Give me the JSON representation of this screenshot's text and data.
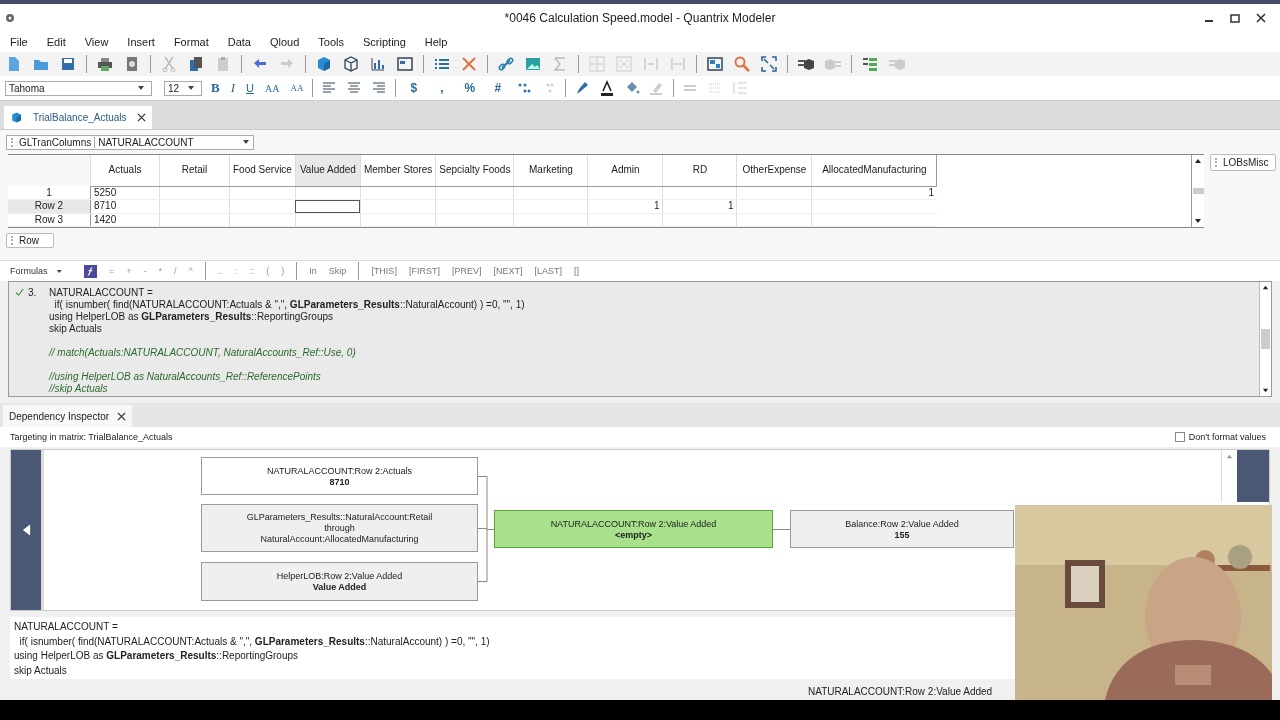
{
  "window": {
    "title": "*0046 Calculation Speed.model - Quantrix Modeler"
  },
  "menu": [
    "File",
    "Edit",
    "View",
    "Insert",
    "Format",
    "Data",
    "Qloud",
    "Tools",
    "Scripting",
    "Help"
  ],
  "format_toolbar": {
    "font": "Tahoma",
    "size": "12",
    "style_buttons": [
      {
        "label": "B",
        "kind": "bold"
      },
      {
        "label": "I",
        "kind": "italic"
      },
      {
        "label": "U",
        "kind": "underline"
      },
      {
        "label": "AA",
        "kind": "grow"
      },
      {
        "label": "AA",
        "kind": "shrink"
      }
    ],
    "number_buttons": [
      "$",
      ",",
      "%",
      "#"
    ]
  },
  "doc_tabs": [
    {
      "label": "TrialBalance_Actuals",
      "selected": true
    }
  ],
  "matrix": {
    "category": "GLTranColumns",
    "item": "NATURALACCOUNT",
    "columns": [
      {
        "label": "Actuals",
        "selected": false
      },
      {
        "label": "Retail",
        "selected": false
      },
      {
        "label": "Food Service",
        "selected": false
      },
      {
        "label": "Value Added",
        "selected": true
      },
      {
        "label": "Member Stores",
        "selected": false
      },
      {
        "label": "Sepcialty Foods",
        "selected": false
      },
      {
        "label": "Marketing",
        "selected": false
      },
      {
        "label": "Admin",
        "selected": false
      },
      {
        "label": "RD",
        "selected": false
      },
      {
        "label": "OtherExpense",
        "selected": false
      },
      {
        "label": "AllocatedManufacturing",
        "selected": false
      }
    ],
    "rows": [
      {
        "header": "1",
        "selected": false,
        "cells": [
          "5250",
          null,
          null,
          null,
          null,
          null,
          null,
          null,
          null,
          null,
          "1"
        ]
      },
      {
        "header": "Row 2",
        "selected": true,
        "cells": [
          "8710",
          null,
          null,
          null,
          null,
          null,
          null,
          "1",
          "1",
          null,
          null
        ]
      },
      {
        "header": "Row 3",
        "selected": false,
        "cells": [
          "1420",
          null,
          null,
          null,
          null,
          null,
          null,
          null,
          null,
          null,
          null
        ]
      }
    ],
    "row_category": "Row",
    "side_category": "LOBsMisc"
  },
  "formula_toolbar": {
    "mode": "Formulas",
    "operators": [
      "=",
      "+",
      "-",
      "*",
      "/",
      "^"
    ],
    "ranges": [
      "..",
      ":",
      "::",
      "(",
      ")"
    ],
    "keywords": [
      "In",
      "Skip"
    ],
    "references": [
      "[THIS]",
      "[FIRST]",
      "[PREV]",
      "[NEXT]",
      "[LAST]",
      "[]"
    ]
  },
  "formula_editor": {
    "number": "3.",
    "valid": true,
    "lines": [
      {
        "kind": "code",
        "text": "NATURALACCOUNT ="
      },
      {
        "kind": "code",
        "text": "  if( isnumber( find(NATURALACCOUNT:Actuals & \",\", **GLParameters_Results**::NaturalAccount) ) =0, \"\", 1)"
      },
      {
        "kind": "code",
        "text": "using HelperLOB as **GLParameters_Results**::ReportingGroups"
      },
      {
        "kind": "code",
        "text": "skip Actuals"
      },
      {
        "kind": "blank"
      },
      {
        "kind": "comment",
        "text": "// match(Actuals:NATURALACCOUNT, NaturalAccounts_Ref::Use, 0)"
      },
      {
        "kind": "blank"
      },
      {
        "kind": "comment",
        "text": "//using HelperLOB as NaturalAccounts_Ref::ReferencePoints"
      },
      {
        "kind": "comment",
        "text": "//skip Actuals"
      }
    ]
  },
  "inspector": {
    "tab": "Dependency Inspector",
    "target": "Targeting in matrix: TrialBalance_Actuals",
    "dont_format": {
      "label": "Don't format values",
      "checked": false
    },
    "nodes": [
      {
        "kind": "precedent",
        "shaded": false,
        "lines": [
          "NATURALACCOUNT:Row 2:Actuals"
        ],
        "value": "8710"
      },
      {
        "kind": "precedent",
        "shaded": true,
        "lines": [
          "GLParameters_Results::NaturalAccount:Retail",
          "through",
          "NaturalAccount:AllocatedManufacturing"
        ]
      },
      {
        "kind": "precedent",
        "shaded": true,
        "lines": [
          "HelperLOB:Row 2:Value Added"
        ],
        "value": "Value Added"
      },
      {
        "kind": "target",
        "shaded": false,
        "lines": [
          "NATURALACCOUNT:Row 2:Value Added"
        ],
        "value": "<empty>"
      },
      {
        "kind": "dependent",
        "shaded": true,
        "lines": [
          "Balance:Row 2:Value Added"
        ],
        "value": "155"
      }
    ],
    "formula": [
      "NATURALACCOUNT =",
      "  if( isnumber( find(NATURALACCOUNT:Actuals & \",\", **GLParameters_Results**::NaturalAccount) ) =0, \"\", 1)",
      "using HelperLOB as **GLParameters_Results**::ReportingGroups",
      "skip Actuals"
    ]
  },
  "status_bar": {
    "text": "NATURALACCOUNT:Row 2:Value Added"
  },
  "webcam": {
    "kind": "picture"
  }
}
